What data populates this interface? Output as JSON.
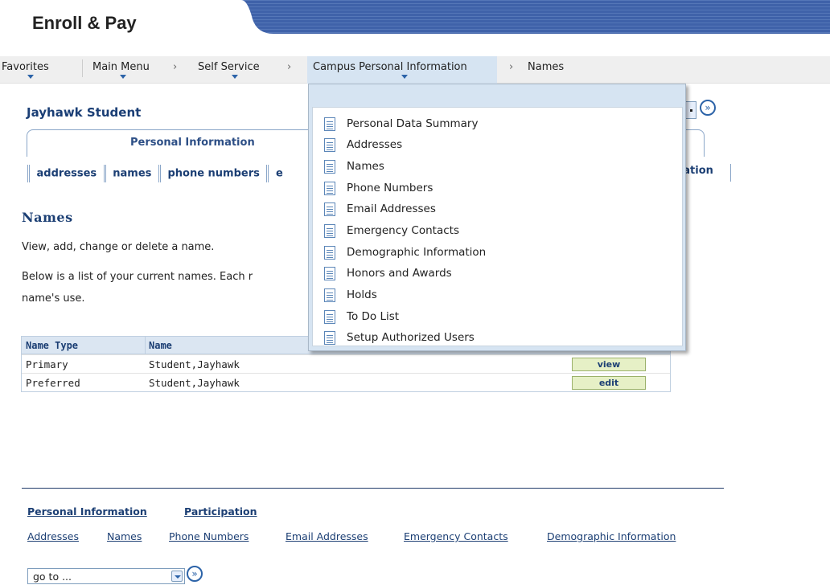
{
  "app": {
    "title": "Enroll & Pay"
  },
  "nav": {
    "favorites": "Favorites",
    "main_menu": "Main Menu",
    "self_service": "Self Service",
    "campus_personal_information": "Campus Personal Information",
    "names": "Names",
    "sep": "›"
  },
  "student": {
    "name": "Jayhawk Student"
  },
  "tabs": {
    "personal_information": "Personal Information"
  },
  "subnav": {
    "items": [
      "addresses",
      "names",
      "phone numbers",
      "e"
    ],
    "right_fragment": "nation"
  },
  "page": {
    "title": "Names",
    "intro": "View, add, change or delete a name.",
    "desc_line1": "Below is a list of your current names. Each r",
    "desc_line2": "name's use."
  },
  "table": {
    "headers": [
      "Name Type",
      "Name"
    ],
    "rows": [
      {
        "type": "Primary",
        "name": "Student,Jayhawk",
        "action": "view"
      },
      {
        "type": "Preferred",
        "name": "Student,Jayhawk",
        "action": "edit"
      }
    ]
  },
  "footer": {
    "top_links": [
      "Personal Information",
      "Participation"
    ],
    "links": [
      "Addresses",
      "Names",
      "Phone Numbers",
      "Email Addresses",
      "Emergency Contacts",
      "Demographic Information"
    ],
    "goto": {
      "value": "go to ...",
      "go_glyph": "»"
    }
  },
  "dropdown": {
    "items": [
      "Personal Data Summary",
      "Addresses",
      "Names",
      "Phone Numbers",
      "Email Addresses",
      "Emergency Contacts",
      "Demographic Information",
      "Honors and Awards",
      "Holds",
      "To Do List",
      "Setup Authorized Users"
    ]
  },
  "colors": {
    "header_band": "#3a5ea6",
    "nav_active": "#d6e4f2",
    "accent_navy": "#1c3f74",
    "button_green": "#e6f0c6"
  },
  "icons": {
    "nav_caret": "chevron-down-icon",
    "go_button": "go-arrow-icon",
    "menu_item": "document-icon"
  }
}
